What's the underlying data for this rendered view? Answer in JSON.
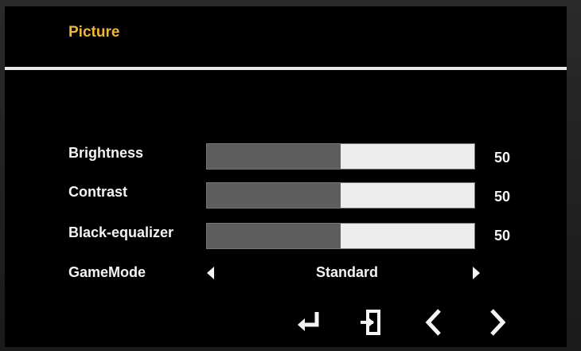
{
  "menu": {
    "title": "Picture"
  },
  "settings": [
    {
      "label": "Brightness",
      "value": "50",
      "level": 0.5
    },
    {
      "label": "Contrast",
      "value": "50",
      "level": 0.5
    },
    {
      "label": "Black-equalizer",
      "value": "50",
      "level": 0.5
    }
  ],
  "game_mode": {
    "label": "GameMode",
    "value": "Standard"
  },
  "nav": {
    "icons": [
      "enter-icon",
      "exit-icon",
      "chevron-left-icon",
      "chevron-right-icon"
    ]
  },
  "colors": {
    "title": "#f3b43a",
    "background": "#000000",
    "bar_fill": "#5d5d5d",
    "bar_track": "#ececec"
  }
}
